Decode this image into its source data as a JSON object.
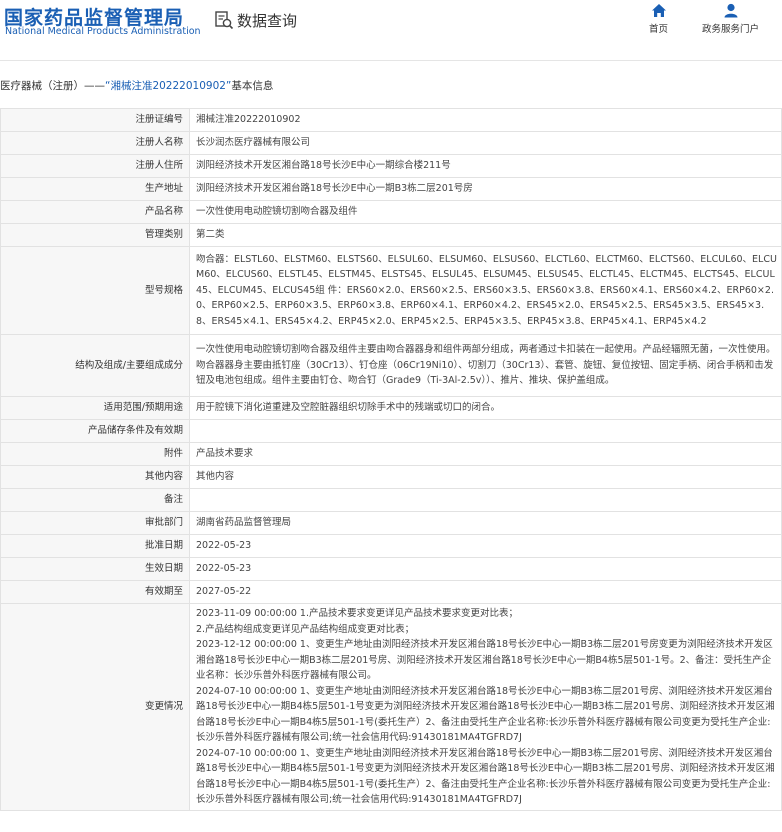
{
  "header": {
    "brand_cn": "国家药品监督管理局",
    "brand_en": "National Medical Products Administration",
    "query_label": "数据查询",
    "nav": [
      {
        "label": "首页",
        "icon": "home-icon"
      },
      {
        "label": "政务服务门户",
        "icon": "user-icon"
      }
    ],
    "brand_color": "#1a5fb4"
  },
  "breadcrumb": {
    "prefix": "医疗器械（注册）——",
    "highlight": "“湘械注准20222010902”",
    "suffix": "基本信息"
  },
  "rows": [
    {
      "key": "注册证编号",
      "value": "湘械注准20222010902"
    },
    {
      "key": "注册人名称",
      "value": "长沙润杰医疗器械有限公司"
    },
    {
      "key": "注册人住所",
      "value": "浏阳经济技术开发区湘台路18号长沙E中心一期综合楼211号"
    },
    {
      "key": "生产地址",
      "value": "浏阳经济技术开发区湘台路18号长沙E中心一期B3栋二层201号房"
    },
    {
      "key": "产品名称",
      "value": "一次性使用电动腔镜切割吻合器及组件"
    },
    {
      "key": "管理类别",
      "value": "第二类"
    },
    {
      "key": "型号规格",
      "value": "吻合器：ELSTL60、ELSTM60、ELSTS60、ELSUL60、ELSUM60、ELSUS60、ELCTL60、ELCTM60、ELCTS60、ELCUL60、ELCUM60、ELCUS60、ELSTL45、ELSTM45、ELSTS45、ELSUL45、ELSUM45、ELSUS45、ELCTL45、ELCTM45、ELCTS45、ELCUL45、ELCUM45、ELCUS45组 件：ERS60×2.0、ERS60×2.5、ERS60×3.5、ERS60×3.8、ERS60×4.1、ERS60×4.2、ERP60×2.0、ERP60×2.5、ERP60×3.5、ERP60×3.8、ERP60×4.1、ERP60×4.2、ERS45×2.0、ERS45×2.5、ERS45×3.5、ERS45×3.8、ERS45×4.1、ERS45×4.2、ERP45×2.0、ERP45×2.5、ERP45×3.5、ERP45×3.8、ERP45×4.1、ERP45×4.2"
    },
    {
      "key": "结构及组成/主要组成成分",
      "value": "一次性使用电动腔镜切割吻合器及组件主要由吻合器器身和组件两部分组成，两者通过卡扣装在一起使用。产品经辐照无菌，一次性使用。吻合器器身主要由抵钉座（30Cr13）、钉仓座（06Cr19Ni10）、切割刀（30Cr13）、套管、旋钮、复位按钮、固定手柄、闭合手柄和击发钮及电池包组成。组件主要由钉仓、吻合钉（Grade9（Ti-3Al-2.5v））、推片、推块、保护盖组成。"
    },
    {
      "key": "适用范围/预期用途",
      "value": "用于腔镜下消化道重建及空腔脏器组织切除手术中的残端或切口的闭合。"
    },
    {
      "key": "产品储存条件及有效期",
      "value": ""
    },
    {
      "key": "附件",
      "value": "产品技术要求"
    },
    {
      "key": "其他内容",
      "value": "其他内容"
    },
    {
      "key": "备注",
      "value": ""
    },
    {
      "key": "审批部门",
      "value": "湖南省药品监督管理局"
    },
    {
      "key": "批准日期",
      "value": "2022-05-23"
    },
    {
      "key": "生效日期",
      "value": "2022-05-23"
    },
    {
      "key": "有效期至",
      "value": "2027-05-22"
    }
  ],
  "changes": {
    "key": "变更情况",
    "segments": [
      "2023-11-09 00:00:00 1.产品技术要求变更详见产品技术要求变更对比表；",
      "2.产品结构组成变更详见产品结构组成变更对比表；",
      "2023-12-12 00:00:00 1、变更生产地址由浏阳经济技术开发区湘台路18号长沙E中心一期B3栋二层201号房变更为浏阳经济技术开发区湘台路18号长沙E中心一期B3栋二层201号房、浏阳经济技术开发区湘台路18号长沙E中心一期B4栋5层501-1号。2、备注：受托生产企业名称：长沙乐普外科医疗器械有限公司。",
      "2024-07-10 00:00:00 1、变更生产地址由浏阳经济技术开发区湘台路18号长沙E中心一期B3栋二层201号房、浏阳经济技术开发区湘台路18号长沙E中心一期B4栋5层501-1号变更为浏阳经济技术开发区湘台路18号长沙E中心一期B3栋二层201号房、浏阳经济技术开发区湘台路18号长沙E中心一期B4栋5层501-1号(委托生产）2、备注由受托生产企业名称:长沙乐普外科医疗器械有限公司变更为受托生产企业:长沙乐普外科医疗器械有限公司;统一社会信用代码:91430181MA4TGFRD7J",
      "2024-07-10 00:00:00 1、变更生产地址由浏阳经济技术开发区湘台路18号长沙E中心一期B3栋二层201号房、浏阳经济技术开发区湘台路18号长沙E中心一期B4栋5层501-1号变更为浏阳经济技术开发区湘台路18号长沙E中心一期B3栋二层201号房、浏阳经济技术开发区湘台路18号长沙E中心一期B4栋5层501-1号(委托生产）2、备注由受托生产企业名称:长沙乐普外科医疗器械有限公司变更为受托生产企业:长沙乐普外科医疗器械有限公司;统一社会信用代码:91430181MA4TGFRD7J"
    ]
  }
}
